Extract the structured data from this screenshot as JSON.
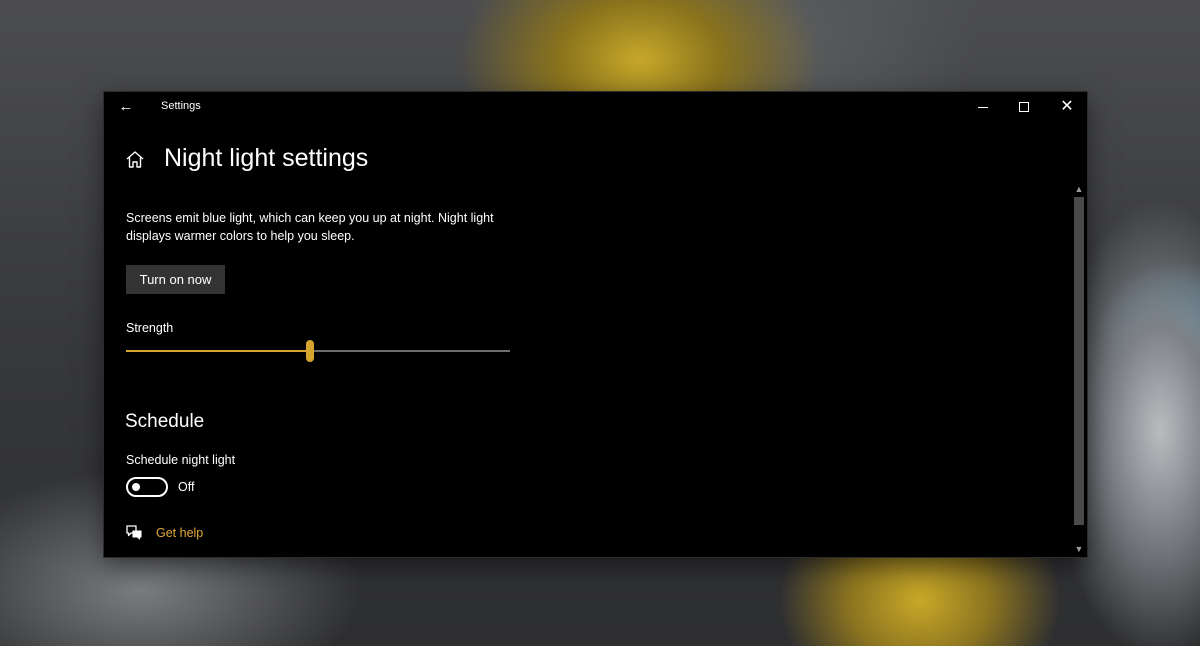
{
  "window": {
    "title": "Settings"
  },
  "page": {
    "title": "Night light settings",
    "description": "Screens emit blue light, which can keep you up at night. Night light displays warmer colors to help you sleep.",
    "turn_on_label": "Turn on now",
    "strength_label": "Strength",
    "strength_value": 48
  },
  "schedule": {
    "section_title": "Schedule",
    "toggle_label": "Schedule night light",
    "toggle_state": "Off",
    "toggle_on": false
  },
  "help": {
    "label": "Get help"
  },
  "icons": {
    "back": "back-arrow-icon",
    "home": "home-icon",
    "minimize": "minimize-icon",
    "maximize": "maximize-icon",
    "close": "close-icon",
    "help": "chat-help-icon",
    "scroll_up": "chevron-up-icon",
    "scroll_down": "chevron-down-icon"
  },
  "colors": {
    "accent": "#d6a52f",
    "link": "#e0a83a",
    "window_bg": "#000000",
    "button_bg": "#333333"
  }
}
